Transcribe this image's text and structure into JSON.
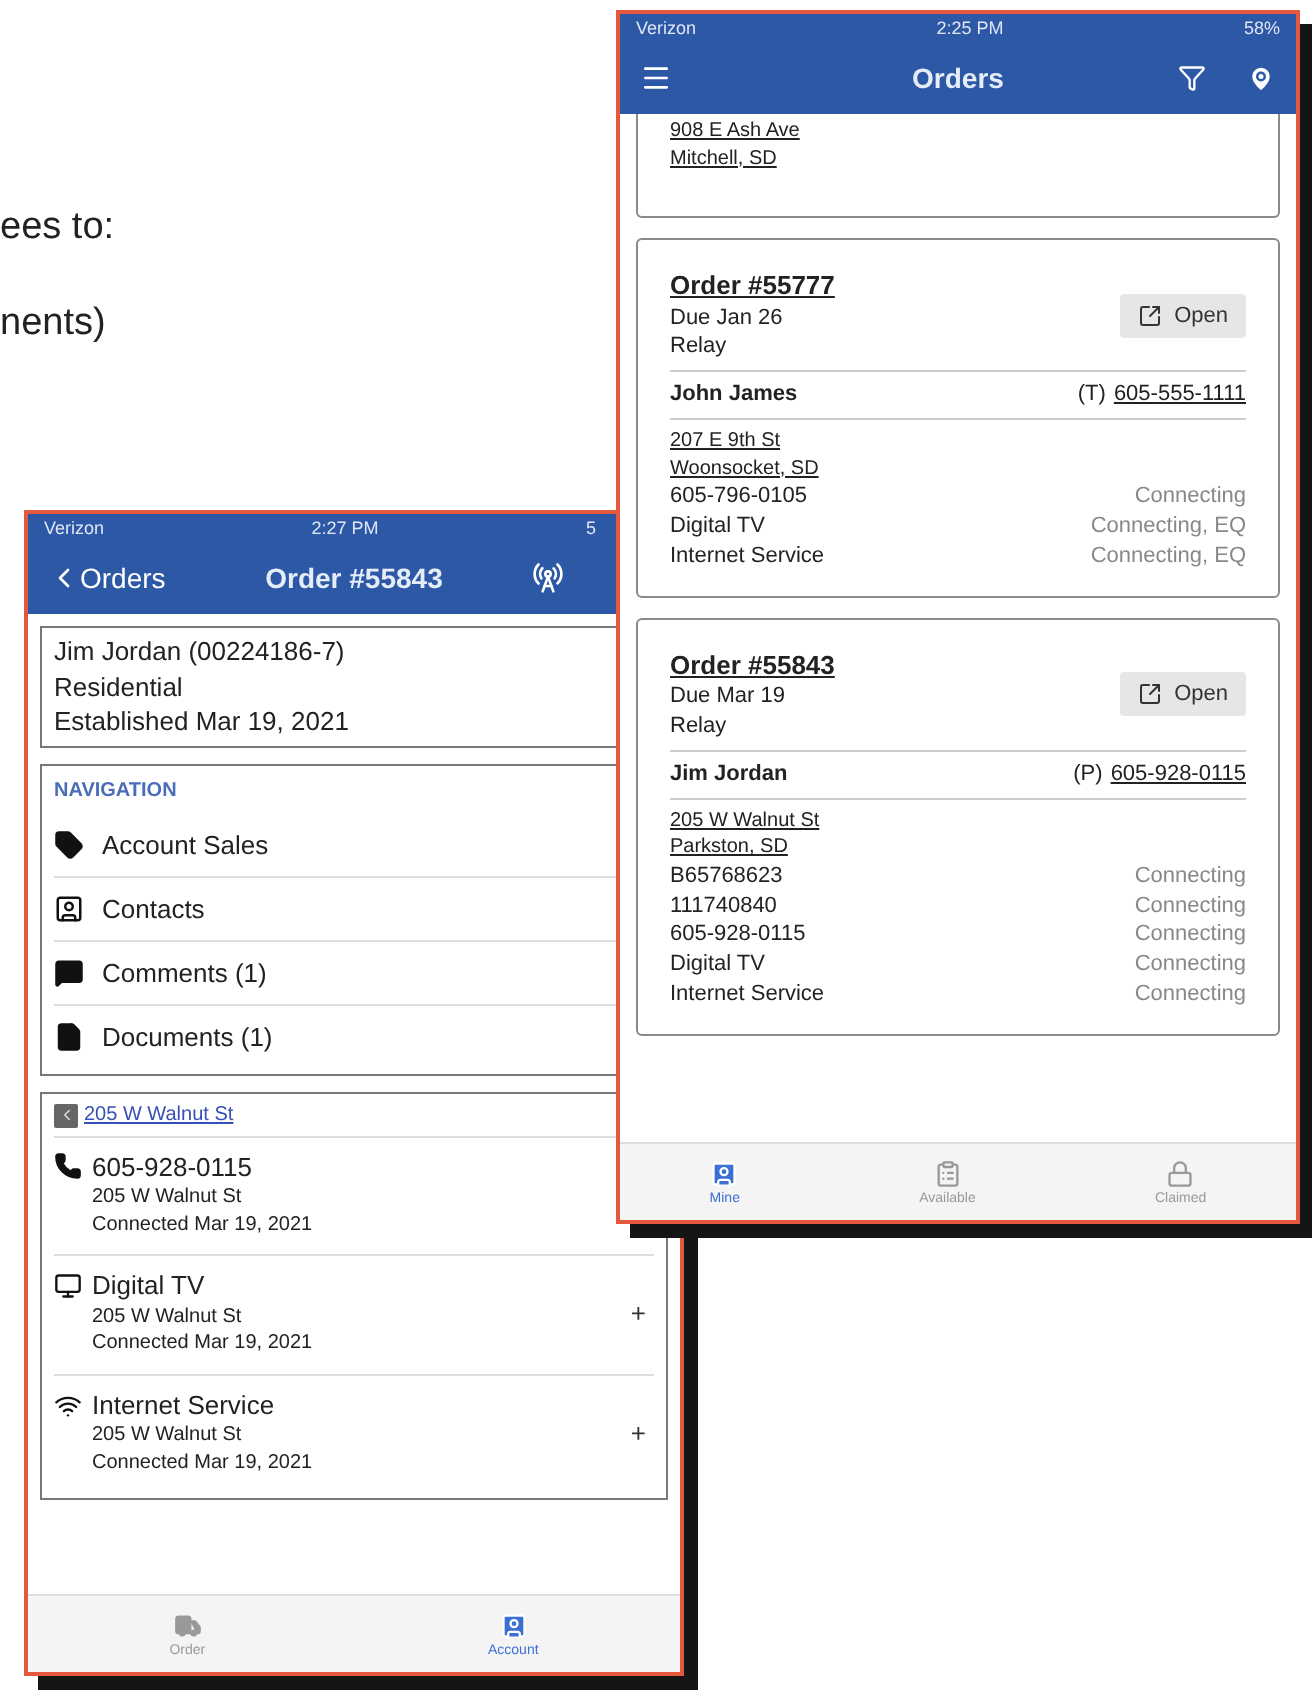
{
  "background_text": [
    "ees to:",
    "nents)"
  ],
  "order_detail_screen": {
    "status_bar": {
      "carrier": "Verizon",
      "time": "2:27 PM",
      "battery": "5"
    },
    "header": {
      "back": "Orders",
      "title": "Order #55843"
    },
    "account_lines": [
      "Jim Jordan (00224186-7)",
      "Residential",
      "Established Mar 19, 2021"
    ],
    "navigation": {
      "title": "NAVIGATION",
      "items": [
        {
          "kind": "tag",
          "label": "Account Sales"
        },
        {
          "kind": "contact",
          "label": "Contacts"
        },
        {
          "kind": "comment",
          "label": "Comments (1)"
        },
        {
          "kind": "document",
          "label": "Documents (1)"
        }
      ]
    },
    "location": {
      "address": "205 W Walnut St",
      "services": [
        {
          "kind": "phone",
          "name": "605-928-0115",
          "address": "205 W Walnut St",
          "status": "Connected Mar 19, 2021"
        },
        {
          "kind": "tv",
          "name": "Digital TV",
          "address": "205 W Walnut St",
          "status": "Connected Mar 19, 2021",
          "action": "+"
        },
        {
          "kind": "wifi",
          "name": "Internet Service",
          "address": "205 W Walnut St",
          "status": "Connected Mar 19, 2021",
          "action": "+"
        }
      ]
    },
    "tabs": [
      {
        "kind": "truck",
        "label": "Order",
        "selected": false
      },
      {
        "kind": "account",
        "label": "Account",
        "selected": true
      }
    ]
  },
  "orders_screen": {
    "status_bar": {
      "carrier": "Verizon",
      "time": "2:25 PM",
      "battery": "58%"
    },
    "header": {
      "title": "Orders"
    },
    "partial_card": {
      "address_lines": [
        "908 E Ash Ave",
        "Mitchell, SD"
      ]
    },
    "orders": [
      {
        "number": "Order #55777",
        "due": "Due Jan 26",
        "type": "Relay",
        "open": "Open",
        "customer": "John James",
        "phone_type": "(T)",
        "phone": "605-555-1111",
        "address_lines": [
          "207 E 9th St",
          "Woonsocket, SD"
        ],
        "services": [
          {
            "name": "605-796-0105",
            "status": "Connecting"
          },
          {
            "name": "Digital TV",
            "status": "Connecting, EQ"
          },
          {
            "name": "Internet Service",
            "status": "Connecting, EQ"
          }
        ]
      },
      {
        "number": "Order #55843",
        "due": "Due Mar 19",
        "type": "Relay",
        "open": "Open",
        "customer": "Jim Jordan",
        "phone_type": "(P)",
        "phone": "605-928-0115",
        "address_lines": [
          "205 W Walnut St",
          "Parkston, SD"
        ],
        "services": [
          {
            "name": "B65768623",
            "status": "Connecting"
          },
          {
            "name": "111740840",
            "status": "Connecting"
          },
          {
            "name": "605-928-0115",
            "status": "Connecting"
          },
          {
            "name": "Digital TV",
            "status": "Connecting"
          },
          {
            "name": "Internet Service",
            "status": "Connecting"
          }
        ]
      }
    ],
    "tabs": [
      {
        "kind": "account",
        "label": "Mine",
        "selected": true
      },
      {
        "kind": "clipboard",
        "label": "Available",
        "selected": false
      },
      {
        "kind": "lock",
        "label": "Claimed",
        "selected": false
      }
    ]
  }
}
